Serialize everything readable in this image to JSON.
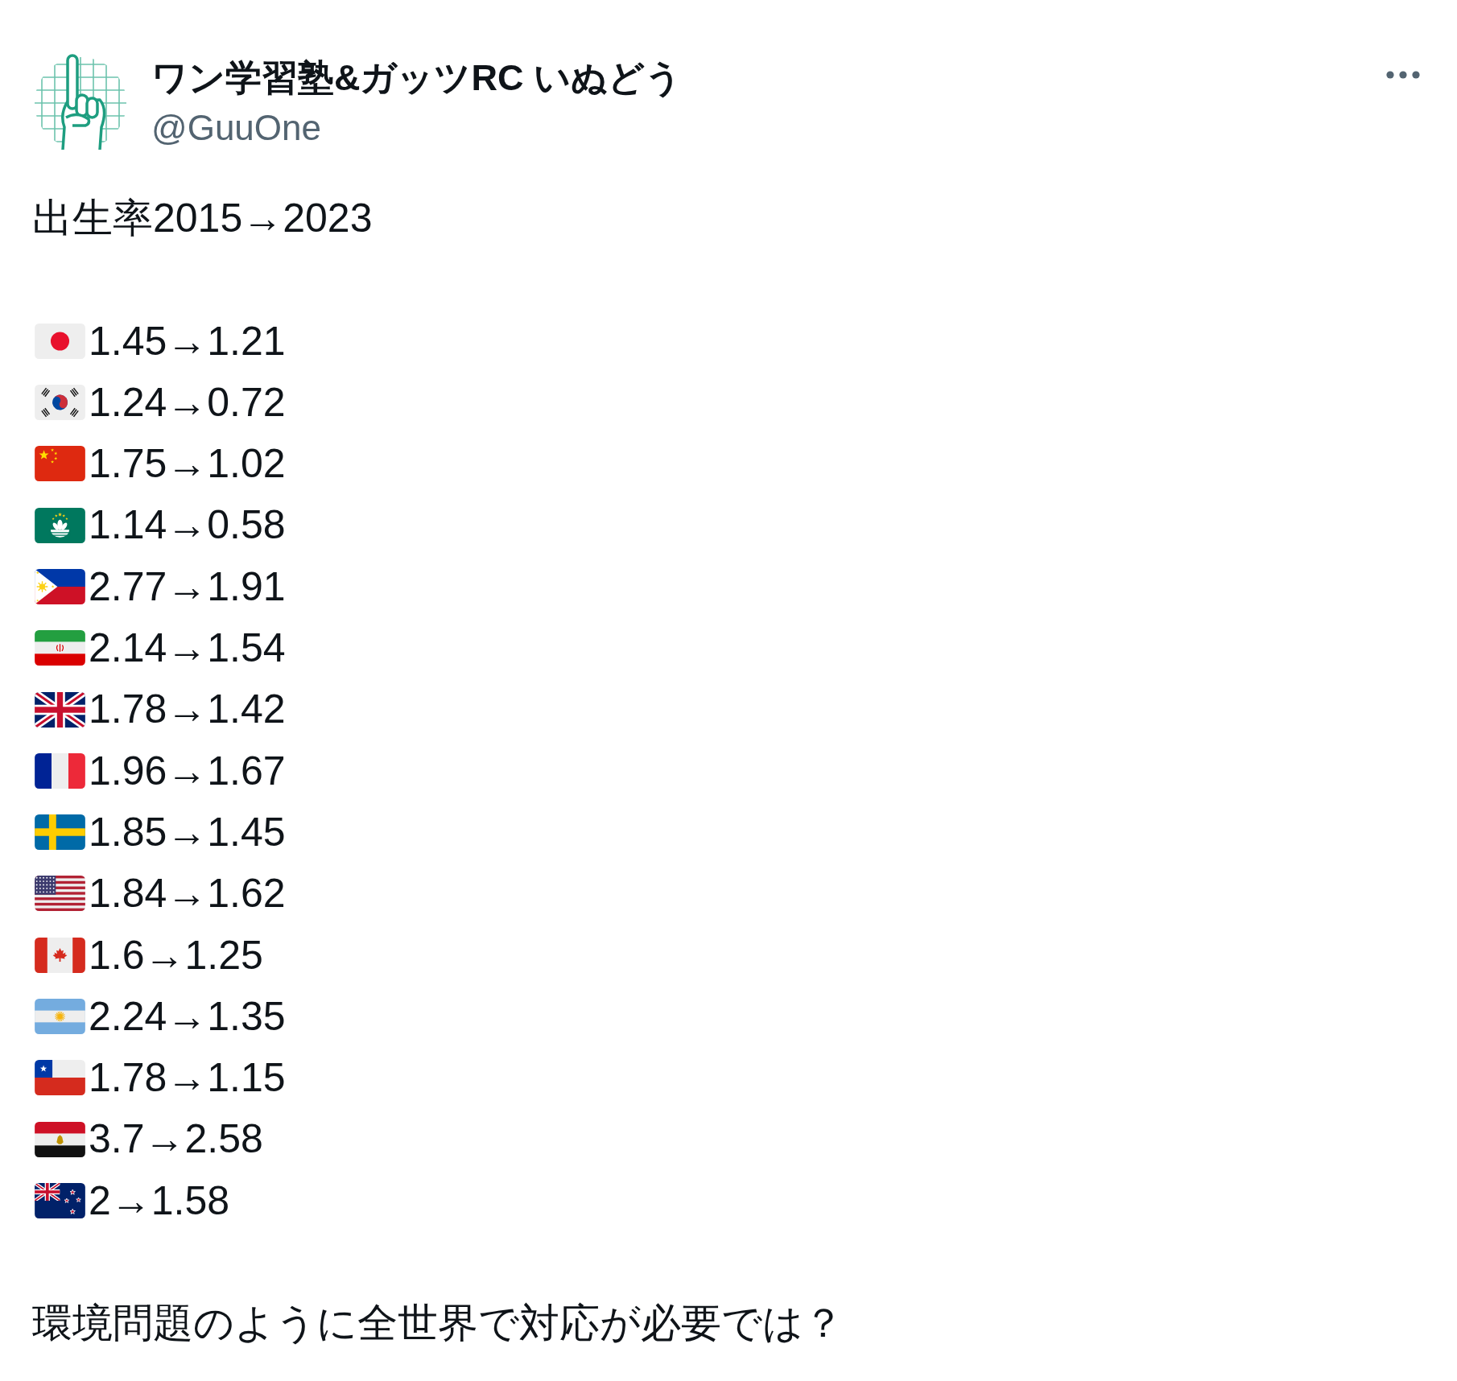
{
  "author": {
    "display_name": "ワン学習塾&ガッツRC いぬどう",
    "handle": "@GuuOne"
  },
  "post": {
    "heading": "出生率2015→2023",
    "rows": [
      {
        "kind": "japan",
        "text": "1.45→1.21"
      },
      {
        "kind": "korea",
        "text": "1.24→0.72"
      },
      {
        "kind": "china",
        "text": "1.75→1.02"
      },
      {
        "kind": "macau",
        "text": "1.14→0.58"
      },
      {
        "kind": "philippines",
        "text": "2.77→1.91"
      },
      {
        "kind": "iran",
        "text": "2.14→1.54"
      },
      {
        "kind": "britain",
        "text": "1.78→1.42"
      },
      {
        "kind": "france",
        "text": "1.96→1.67"
      },
      {
        "kind": "sweden",
        "text": "1.85→1.45"
      },
      {
        "kind": "usa",
        "text": "1.84→1.62"
      },
      {
        "kind": "canada",
        "text": "1.6→1.25"
      },
      {
        "kind": "argentina",
        "text": "2.24→1.35"
      },
      {
        "kind": "chile",
        "text": "1.78→1.15"
      },
      {
        "kind": "egypt",
        "text": "3.7→2.58"
      },
      {
        "kind": "newzealand",
        "text": "2→1.58"
      }
    ],
    "closing": "環境問題のように全世界で対応が必要では？"
  }
}
